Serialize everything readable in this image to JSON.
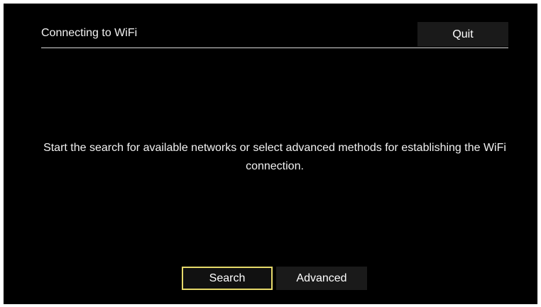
{
  "header": {
    "title": "Connecting to WiFi",
    "quit_label": "Quit"
  },
  "main": {
    "message": "Start the search for available networks or select advanced methods for establishing the WiFi connection."
  },
  "actions": {
    "search_label": "Search",
    "advanced_label": "Advanced",
    "focused": "Search"
  },
  "colors": {
    "background": "#000000",
    "focus_outline": "#e6d96a",
    "button_bg": "#1a1a1a",
    "text": "#ffffff"
  }
}
